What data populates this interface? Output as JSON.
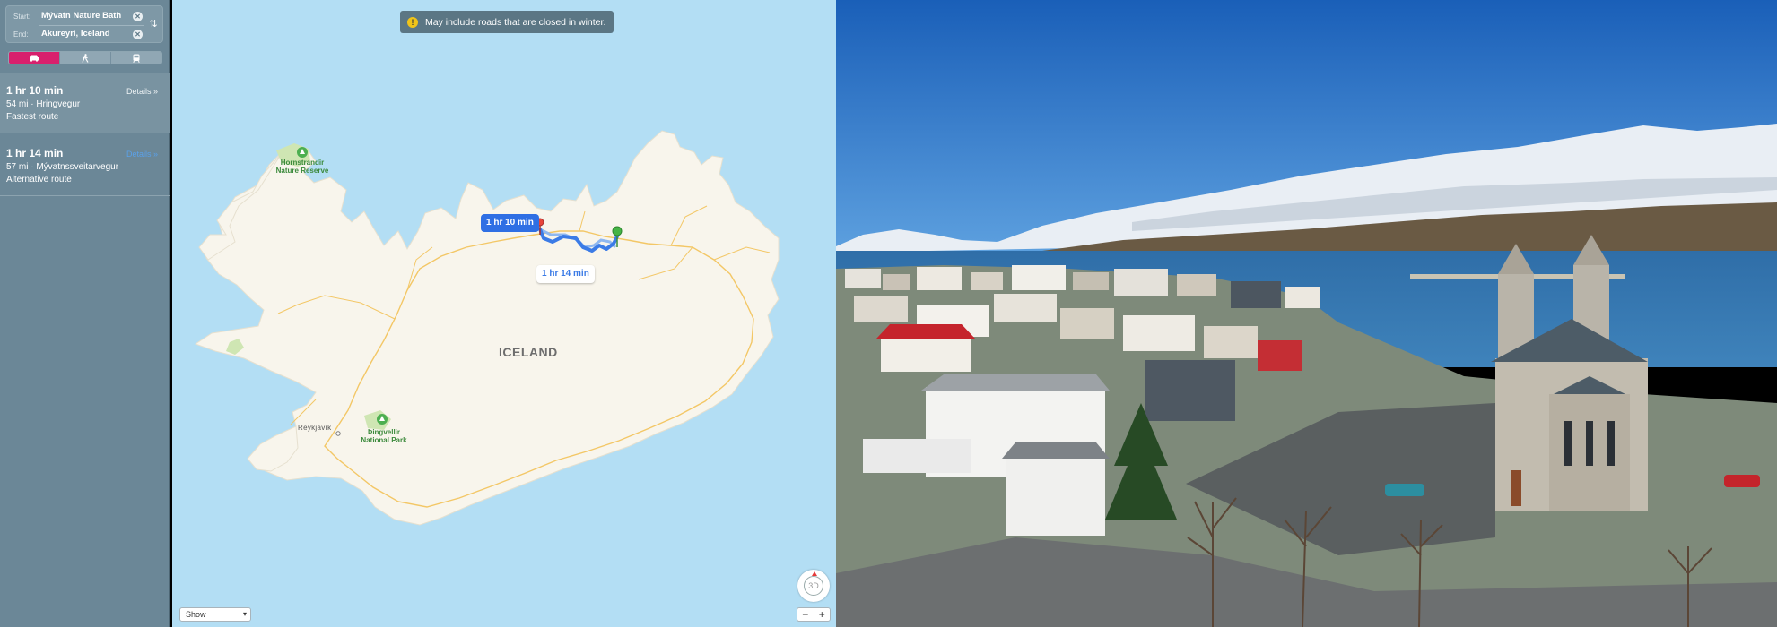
{
  "directions": {
    "start_label": "Start:",
    "start_value": "Mývatn Nature Bath",
    "end_label": "End:",
    "end_value": "Akureyri, Iceland",
    "clear_glyph": "✕",
    "swap_glyph": "⇅",
    "modes": [
      {
        "name": "driving",
        "icon": "car-icon",
        "active": true
      },
      {
        "name": "walking",
        "icon": "walking-icon",
        "active": false
      },
      {
        "name": "transit",
        "icon": "transit-icon",
        "active": false
      }
    ],
    "routes": [
      {
        "time": "1 hr 10 min",
        "distance": "54 mi · Hringvegur",
        "type": "Fastest route",
        "details": "Details »"
      },
      {
        "time": "1 hr 14 min",
        "distance": "57 mi · Mývatnssveitarvegur",
        "type": "Alternative route",
        "details": "Details »"
      }
    ]
  },
  "map": {
    "warning": "May include roads that are closed in winter.",
    "warning_glyph": "!",
    "callout_primary": "1 hr 10 min",
    "callout_alt": "1 hr 14 min",
    "country_label": "ICELAND",
    "poi_horn": "Hornstrandir Nature Reserve",
    "poi_thing": "Þingvellir National Park",
    "city": "Reykjavík",
    "show_label": "Show",
    "compass_label": "3D",
    "zoom_out": "−",
    "zoom_in": "+",
    "colors": {
      "water": "#b3def4",
      "land": "#f8f5ec",
      "route": "#3b7be6",
      "road": "#f3c766",
      "park": "#cfe6b3"
    }
  },
  "photo": {
    "subject": "Akureyri town view with Akureyrarkirkja church and snowy mountains",
    "colors": {
      "sky": "#1f6ec4",
      "water": "#3b7fb7",
      "snow": "#eef2f6"
    }
  }
}
